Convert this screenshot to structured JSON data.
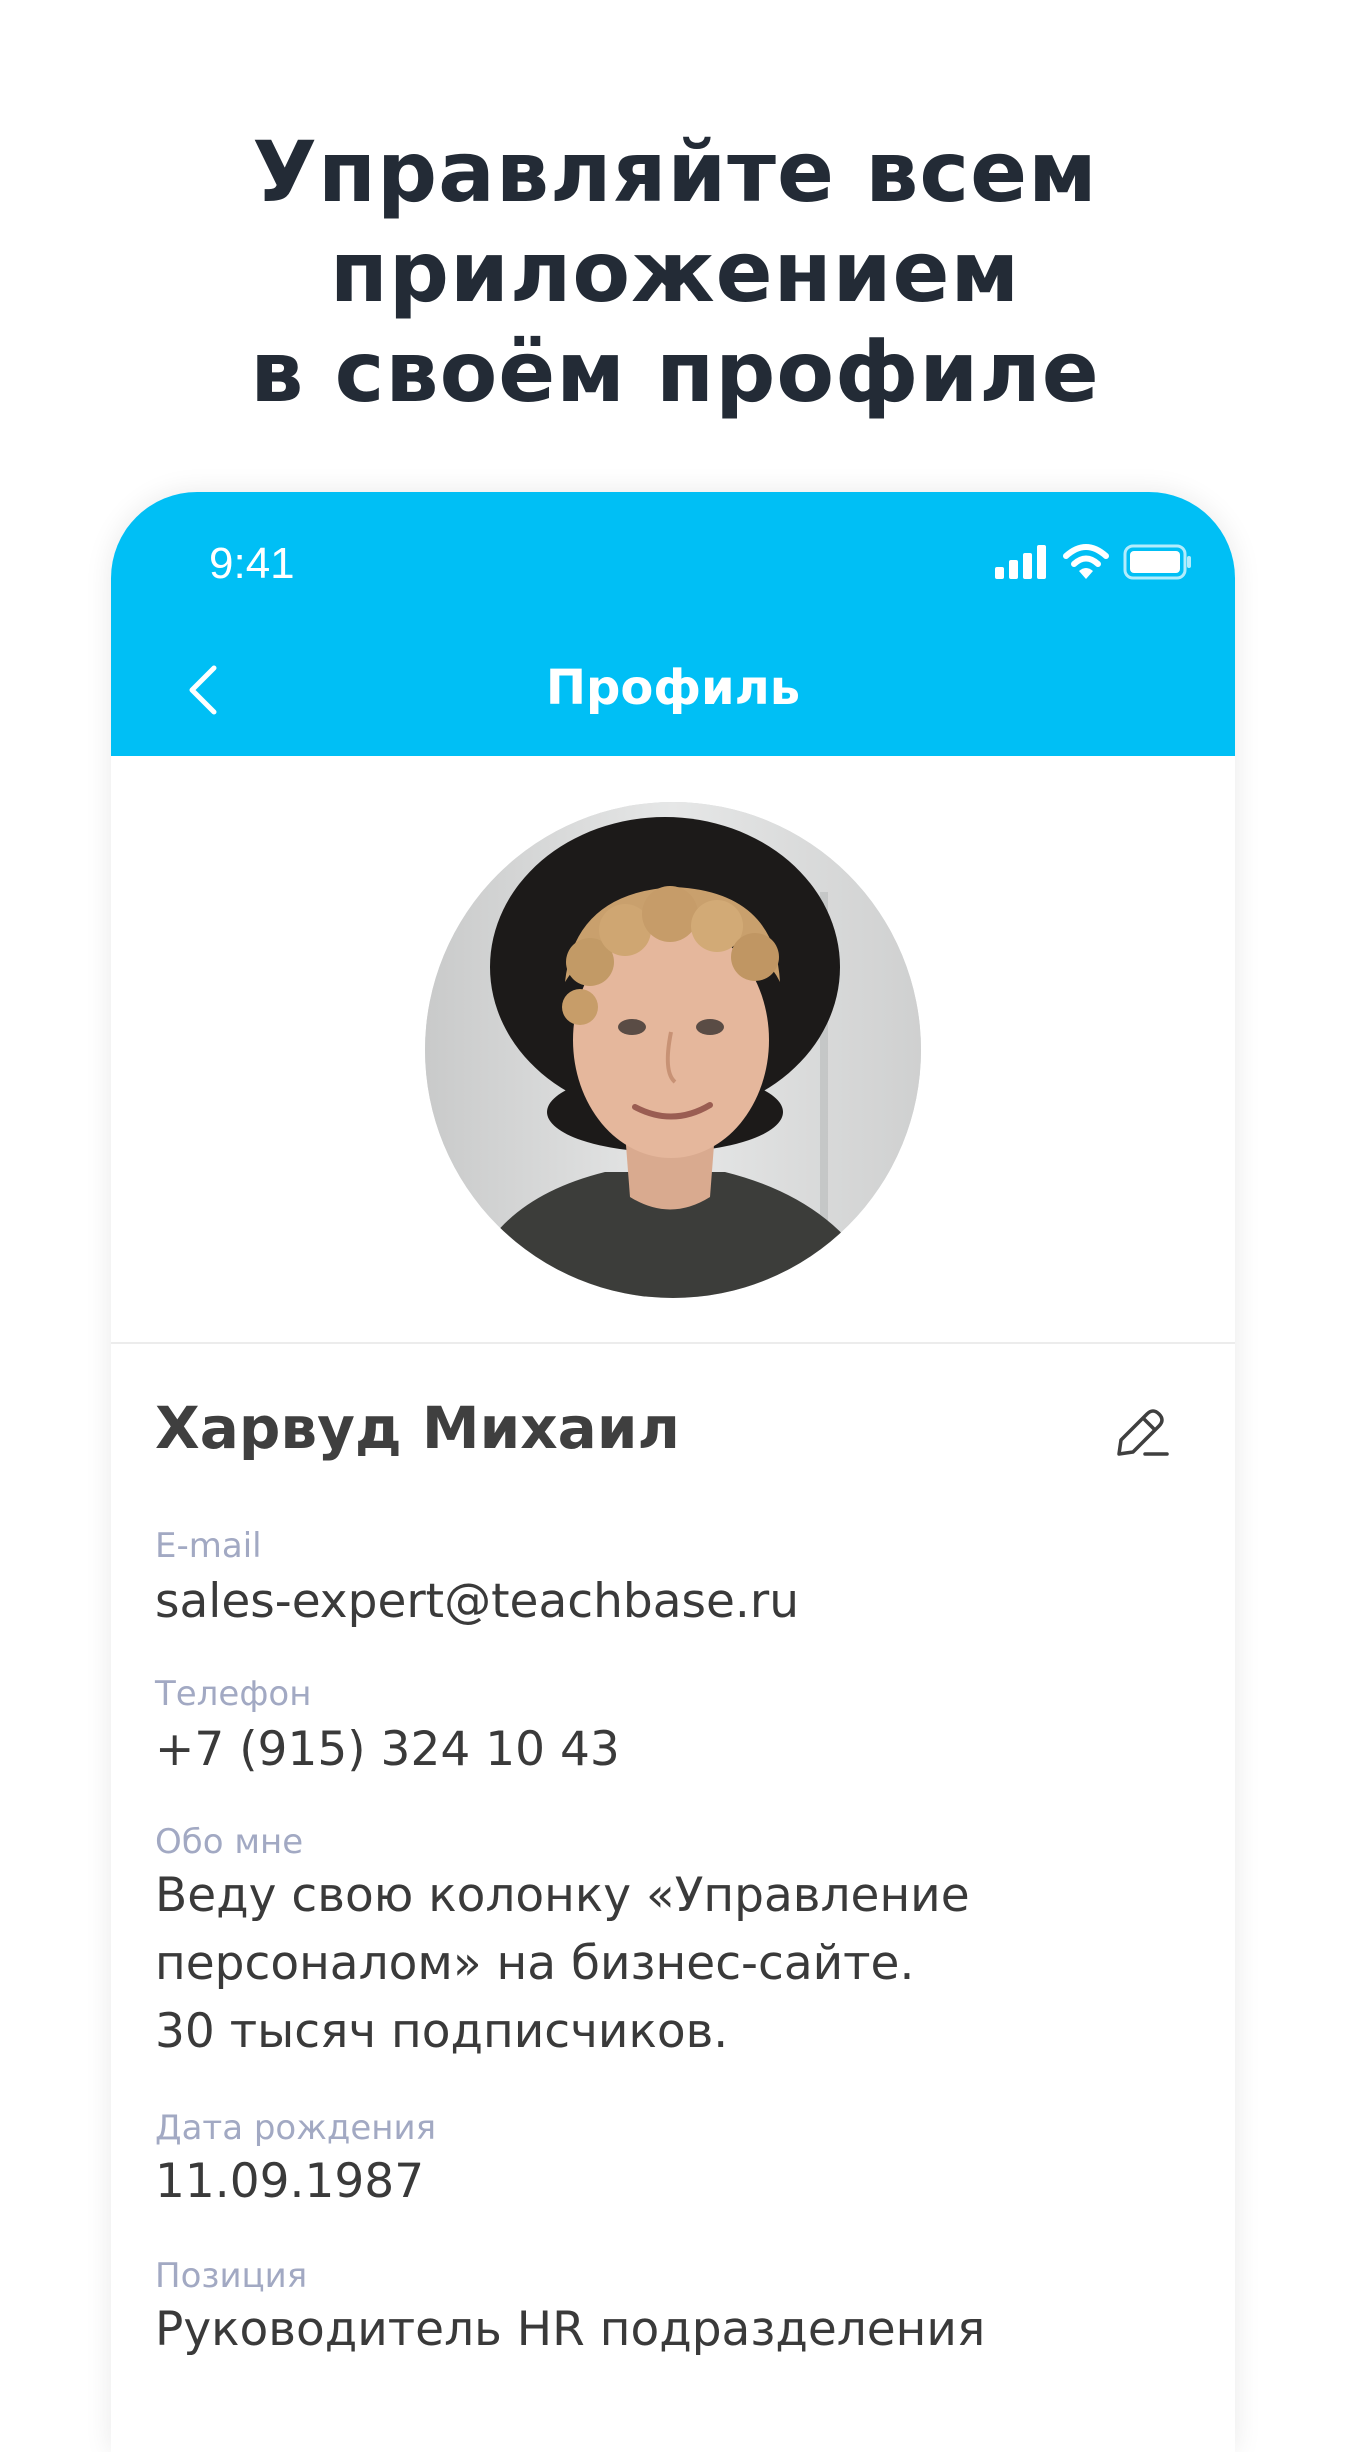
{
  "headline": {
    "line1": "Управляйте всем",
    "line2": "приложением",
    "line3": "в своём профиле"
  },
  "status_bar": {
    "time": "9:41",
    "icons": [
      "cellular-signal-icon",
      "wifi-icon",
      "battery-icon"
    ]
  },
  "nav": {
    "back_icon": "chevron-left-icon",
    "title": "Профиль"
  },
  "profile": {
    "avatar": "user-avatar-photo",
    "name": "Харвуд Михаил",
    "edit_icon": "pencil-icon",
    "fields": [
      {
        "label": "E-mail",
        "value": "sales-expert@teachbase.ru"
      },
      {
        "label": "Телефон",
        "value": "+7 (915) 324 10 43"
      },
      {
        "label": "Обо мне",
        "value": "Веду свою колонку «Управление\nперсоналом» на бизнес-сайте.\n30 тысяч подписчиков."
      },
      {
        "label": "Дата рождения",
        "value": "11.09.1987"
      },
      {
        "label": "Позиция",
        "value": "Руководитель HR подразделения"
      }
    ]
  },
  "colors": {
    "header_background": "#00bff5",
    "headline_text": "#232b36",
    "label_text": "#a2a9c3",
    "value_text": "#3a3a3a"
  }
}
